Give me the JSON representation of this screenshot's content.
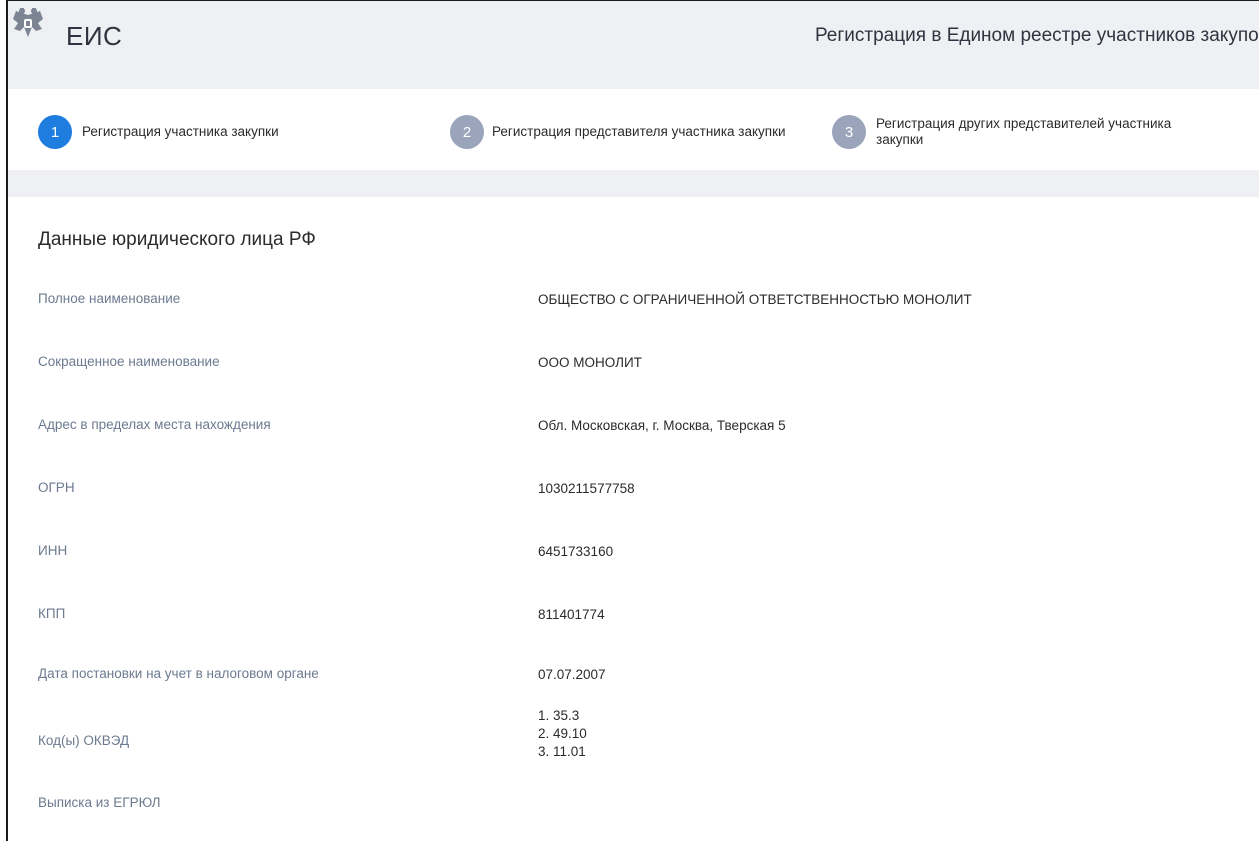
{
  "header": {
    "brand": "ЕИС",
    "title": "Регистрация в Едином реестре участников закупок"
  },
  "stepper": {
    "steps": [
      {
        "number": "1",
        "label": "Регистрация участника закупки",
        "state": "active"
      },
      {
        "number": "2",
        "label": "Регистрация представителя участника закупки",
        "state": "inactive"
      },
      {
        "number": "3",
        "label": "Регистрация других представителей участника закупки",
        "state": "inactive"
      }
    ]
  },
  "section": {
    "title": "Данные юридического лица РФ",
    "fields": {
      "full_name": {
        "label": "Полное наименование",
        "value": "ОБЩЕСТВО С ОГРАНИЧЕННОЙ ОТВЕТСТВЕННОСТЬЮ МОНОЛИТ"
      },
      "short_name": {
        "label": "Сокращенное наименование",
        "value": "ООО МОНОЛИТ"
      },
      "address": {
        "label": "Адрес в пределах места нахождения",
        "value": "Обл. Московская, г. Москва, Тверская 5"
      },
      "ogrn": {
        "label": "ОГРН",
        "value": "1030211577758"
      },
      "inn": {
        "label": "ИНН",
        "value": "6451733160"
      },
      "kpp": {
        "label": "КПП",
        "value": "811401774"
      },
      "tax_date": {
        "label": "Дата постановки на учет в налоговом органе",
        "value": "07.07.2007"
      },
      "okved": {
        "label": "Код(ы) ОКВЭД",
        "values": [
          "1. 35.3",
          "2. 49.10",
          "3. 11.01"
        ]
      },
      "egrul": {
        "label": "Выписка из ЕГРЮЛ"
      }
    }
  },
  "colors": {
    "header_bg": "#eef0f3",
    "step_active": "#1f7de0",
    "step_inactive": "#9aa4bb",
    "label_color": "#6c7a8f"
  }
}
